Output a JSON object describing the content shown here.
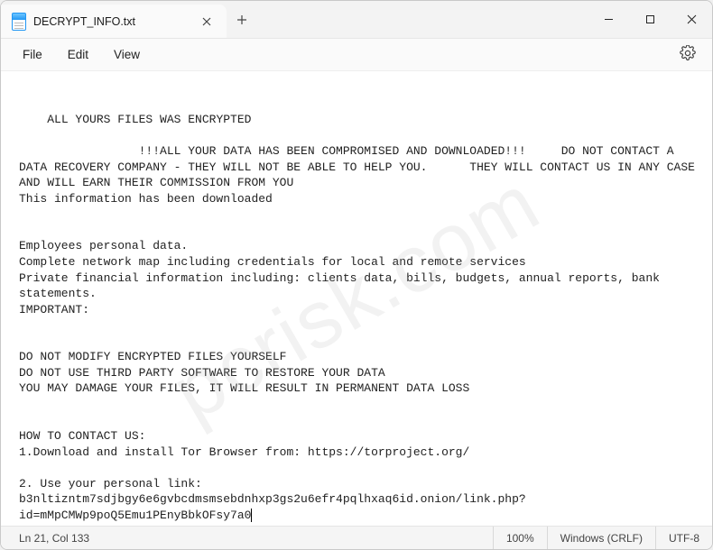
{
  "window": {
    "tab_title": "DECRYPT_INFO.txt"
  },
  "menu": {
    "file": "File",
    "edit": "Edit",
    "view": "View"
  },
  "document": {
    "lines": [
      "ALL YOURS FILES WAS ENCRYPTED",
      "",
      "                 !!!ALL YOUR DATA HAS BEEN COMPROMISED AND DOWNLOADED!!!     DO NOT CONTACT A DATA RECOVERY COMPANY - THEY WILL NOT BE ABLE TO HELP YOU.      THEY WILL CONTACT US IN ANY CASE AND WILL EARN THEIR COMMISSION FROM YOU",
      "This information has been downloaded",
      "",
      "",
      "Employees personal data.",
      "Complete network map including credentials for local and remote services",
      "Private financial information including: clients data, bills, budgets, annual reports, bank statements.",
      "IMPORTANT:",
      "",
      "",
      "DO NOT MODIFY ENCRYPTED FILES YOURSELF",
      "DO NOT USE THIRD PARTY SOFTWARE TO RESTORE YOUR DATA",
      "YOU MAY DAMAGE YOUR FILES, IT WILL RESULT IN PERMANENT DATA LOSS",
      "",
      "",
      "HOW TO CONTACT US:",
      "1.Download and install Tor Browser from: https://torproject.org/",
      "",
      "2. Use your personal link: b3nltizntm7sdjbgy6e6gvbcdmsmsebdnhxp3gs2u6efr4pqlhxaq6id.onion/link.php?id=mMpCMWp9poQ5Emu1PEnyBbkOFsy7a0"
    ]
  },
  "status": {
    "position": "Ln 21, Col 133",
    "zoom": "100%",
    "line_ending": "Windows (CRLF)",
    "encoding": "UTF-8"
  },
  "watermark": "pcrisk.com"
}
